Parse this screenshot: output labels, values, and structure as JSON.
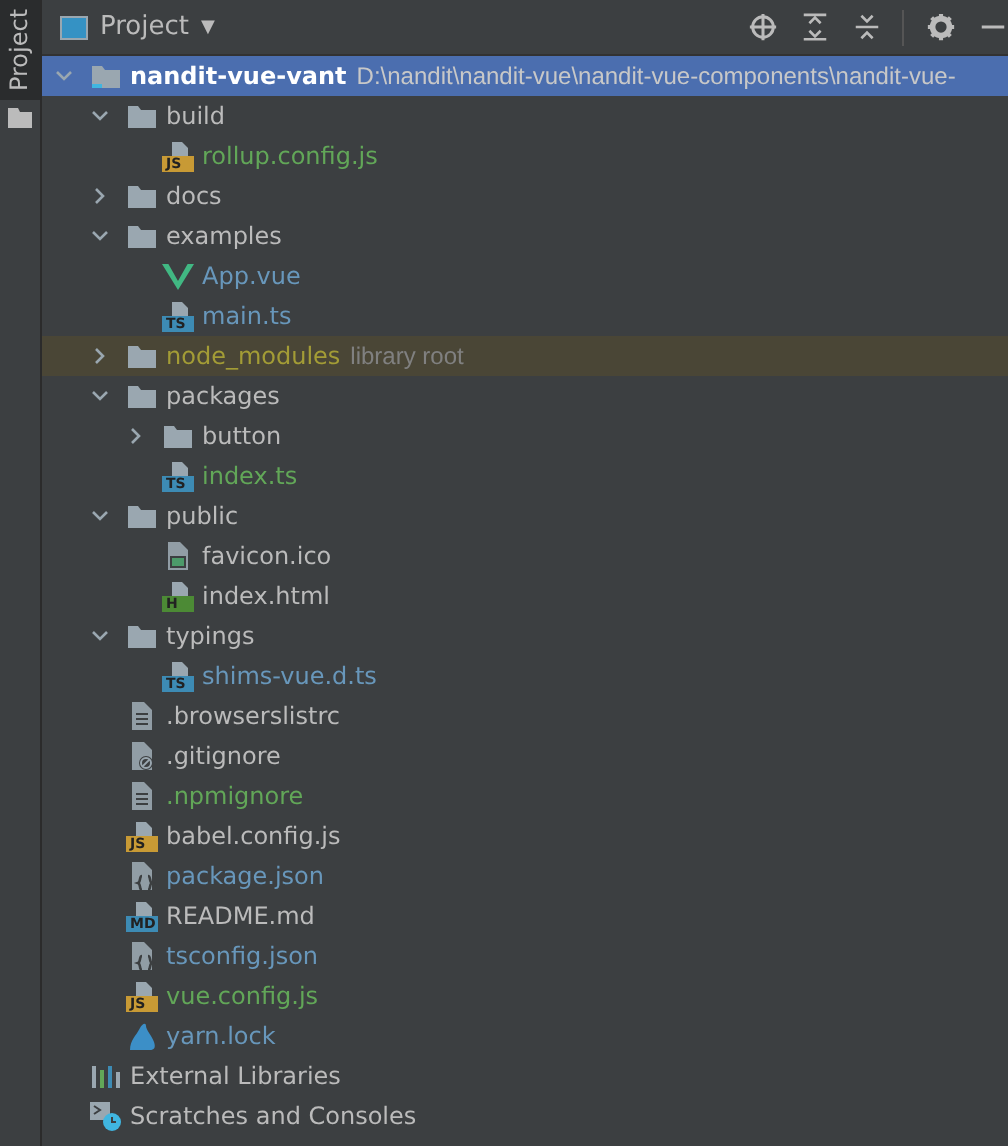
{
  "side_tabs": [
    {
      "label": "Project",
      "selected": true
    }
  ],
  "header": {
    "title": "Project",
    "dropdown": "▼"
  },
  "tree": [
    {
      "name": "nandit-vue-vant",
      "note": "D:\\nandit\\nandit-vue\\nandit-vue-components\\nandit-vue-",
      "kind": "module",
      "color": "#ffffff",
      "selected": true,
      "expanded": true,
      "children": [
        {
          "name": "build",
          "kind": "folder",
          "color": "#bbbbbb",
          "selected": false,
          "expanded": true,
          "children": [
            {
              "name": "rollup.config.js",
              "kind": "file",
              "badge": "JS",
              "color": "#62a758",
              "selected": false
            }
          ]
        },
        {
          "name": "docs",
          "kind": "folder",
          "color": "#bbbbbb",
          "selected": false,
          "expanded": false
        },
        {
          "name": "examples",
          "kind": "folder",
          "color": "#bbbbbb",
          "selected": false,
          "expanded": true,
          "children": [
            {
              "name": "App.vue",
              "kind": "vue",
              "color": "#6897bb",
              "selected": false
            },
            {
              "name": "main.ts",
              "kind": "file",
              "badge": "TS",
              "color": "#6897bb",
              "selected": false
            }
          ]
        },
        {
          "name": "node_modules",
          "note": "library root",
          "kind": "library",
          "color": "#a39c36",
          "selected": false,
          "expanded": false
        },
        {
          "name": "packages",
          "kind": "folder",
          "color": "#bbbbbb",
          "selected": false,
          "expanded": true,
          "children": [
            {
              "name": "button",
              "kind": "folder",
              "color": "#bbbbbb",
              "selected": false,
              "expanded": false
            },
            {
              "name": "index.ts",
              "kind": "file",
              "badge": "TS",
              "color": "#62a758",
              "selected": false
            }
          ]
        },
        {
          "name": "public",
          "kind": "folder",
          "color": "#bbbbbb",
          "selected": false,
          "expanded": true,
          "children": [
            {
              "name": "favicon.ico",
              "kind": "image",
              "color": "#bbbbbb",
              "selected": false
            },
            {
              "name": "index.html",
              "kind": "file",
              "badge": "H",
              "color": "#bbbbbb",
              "selected": false
            }
          ]
        },
        {
          "name": "typings",
          "kind": "folder",
          "color": "#bbbbbb",
          "selected": false,
          "expanded": true,
          "children": [
            {
              "name": "shims-vue.d.ts",
              "kind": "file",
              "badge": "TS",
              "color": "#6897bb",
              "selected": false
            }
          ]
        },
        {
          "name": ".browserslistrc",
          "kind": "text",
          "color": "#bbbbbb",
          "selected": false
        },
        {
          "name": ".gitignore",
          "kind": "ignore",
          "color": "#bbbbbb",
          "selected": false
        },
        {
          "name": ".npmignore",
          "kind": "text",
          "color": "#62a758",
          "selected": false
        },
        {
          "name": "babel.config.js",
          "kind": "file",
          "badge": "JS",
          "color": "#bbbbbb",
          "selected": false
        },
        {
          "name": "package.json",
          "kind": "json",
          "color": "#6897bb",
          "selected": false
        },
        {
          "name": "README.md",
          "kind": "file",
          "badge": "MD",
          "color": "#bbbbbb",
          "selected": false
        },
        {
          "name": "tsconfig.json",
          "kind": "json",
          "color": "#6897bb",
          "selected": false
        },
        {
          "name": "vue.config.js",
          "kind": "file",
          "badge": "JS",
          "color": "#62a758",
          "selected": false
        },
        {
          "name": "yarn.lock",
          "kind": "yarn",
          "color": "#6897bb",
          "selected": false
        }
      ]
    },
    {
      "name": "External Libraries",
      "kind": "libraries",
      "color": "#bbbbbb",
      "selected": false
    },
    {
      "name": "Scratches and Consoles",
      "kind": "scratches",
      "color": "#bbbbbb",
      "selected": false
    }
  ]
}
